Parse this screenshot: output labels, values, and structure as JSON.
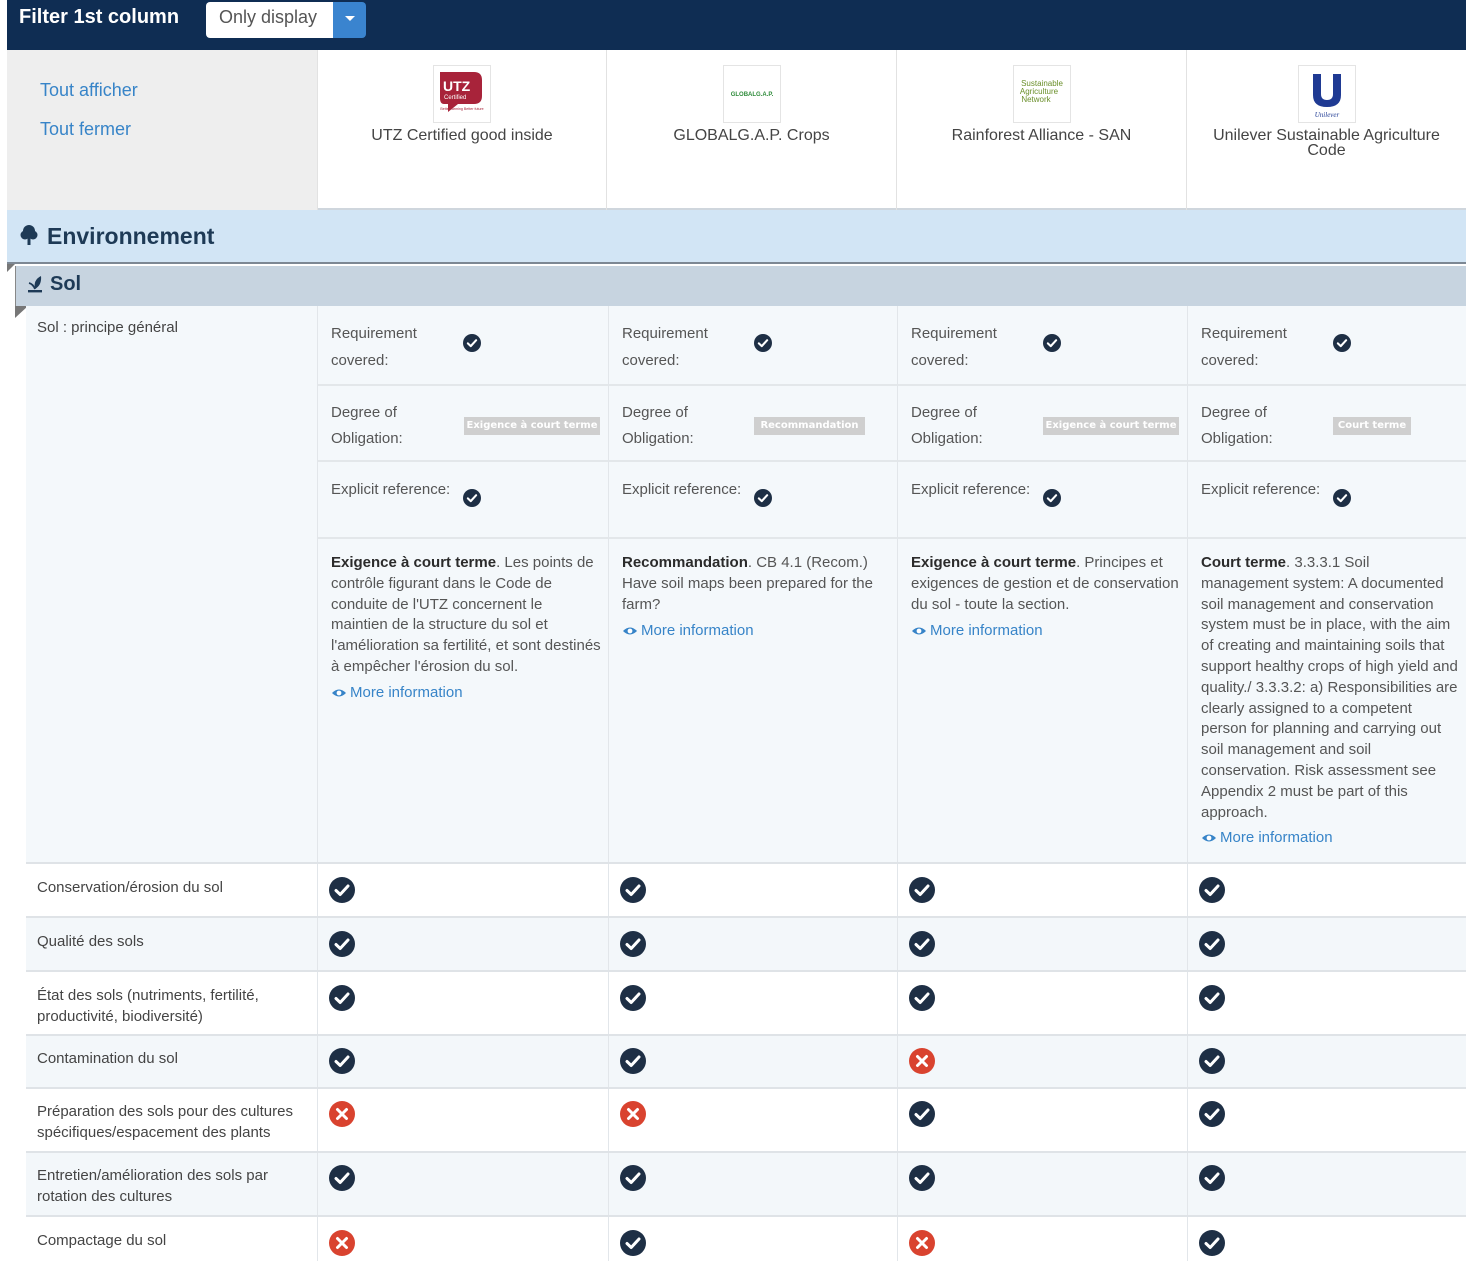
{
  "filter": {
    "label": "Filter 1st column",
    "selected": "Only display"
  },
  "left_links": {
    "show_all": "Tout afficher",
    "close_all": "Tout fermer"
  },
  "standards": [
    {
      "name": "UTZ Certified good inside",
      "logo_icon": "utz-logo-icon"
    },
    {
      "name": "GLOBALG.A.P. Crops",
      "logo_icon": "globalgap-logo-icon"
    },
    {
      "name": "Rainforest Alliance - SAN",
      "logo_icon": "san-logo-icon"
    },
    {
      "name": "Unilever Sustainable Agriculture Code",
      "logo_icon": "unilever-logo-icon"
    }
  ],
  "logos": {
    "utz_main": "UTZ",
    "utz_sub": "Certified",
    "utz_tag": "Better farming Better future",
    "globalgap": "GLOBALG.A.P.",
    "san_1": "Sustainable",
    "san_2": "Agriculture",
    "san_3": "Network",
    "unilever": "Unilever"
  },
  "section": {
    "title": "Environnement",
    "icon": "tree-icon"
  },
  "subsection": {
    "title": "Sol",
    "icon": "plant-icon"
  },
  "detail": {
    "label": "Sol : principe général",
    "req_label_1": "Requirement",
    "req_label_2": "covered:",
    "deg_label_1": "Degree of",
    "deg_label_2": "Obligation:",
    "exp_label": "Explicit reference:",
    "more_label": "More information",
    "cols": [
      {
        "badge": "Exigence à court terme",
        "lead": "Exigence à court terme",
        "text": ". Les points de contrôle figurant dans le Code de conduite de l'UTZ concernent le maintien de la structure du sol et l'amélioration sa fertilité, et sont destinés à empêcher l'érosion du sol."
      },
      {
        "badge": "Recommandation",
        "lead": "Recommandation",
        "text": ". CB 4.1 (Recom.) Have soil maps been prepared for the farm?"
      },
      {
        "badge": "Exigence à court terme",
        "lead": "Exigence à court terme",
        "text": ". Principes et exigences de gestion et de conservation du sol - toute la section."
      },
      {
        "badge": "Court terme",
        "lead": "Court terme",
        "text": ". 3.3.3.1 Soil management system: A documented soil management and conservation system must be in place, with the aim of creating and maintaining soils that support healthy crops of high yield and quality./ 3.3.3.2: a) Responsibilities are clearly assigned to a competent person for planning and carrying out soil management and soil conservation. Risk assessment see Appendix 2 must be part of this approach."
      }
    ]
  },
  "rows": [
    {
      "label": "Conservation/érosion du sol",
      "status": [
        "yes",
        "yes",
        "yes",
        "yes"
      ]
    },
    {
      "label": "Qualité des sols",
      "status": [
        "yes",
        "yes",
        "yes",
        "yes"
      ]
    },
    {
      "label": "État des sols (nutriments, fertilité, productivité, biodiversité)",
      "status": [
        "yes",
        "yes",
        "yes",
        "yes"
      ]
    },
    {
      "label": "Contamination du sol",
      "status": [
        "yes",
        "yes",
        "no",
        "yes"
      ]
    },
    {
      "label": "Préparation des sols pour des cultures spécifiques/espacement des plants",
      "status": [
        "no",
        "no",
        "yes",
        "yes"
      ]
    },
    {
      "label": "Entretien/amélioration des sols par rotation des cultures",
      "status": [
        "yes",
        "yes",
        "yes",
        "yes"
      ]
    },
    {
      "label": "Compactage du sol",
      "status": [
        "no",
        "yes",
        "no",
        "yes"
      ]
    }
  ],
  "colors": {
    "topbar": "#0f2d53",
    "link": "#3784c8",
    "section_band": "#d2e5f5",
    "subsection_band": "#c7d4e0",
    "yes": "#1e2f45",
    "no": "#d9432f",
    "badge": "#cfcfcf"
  }
}
